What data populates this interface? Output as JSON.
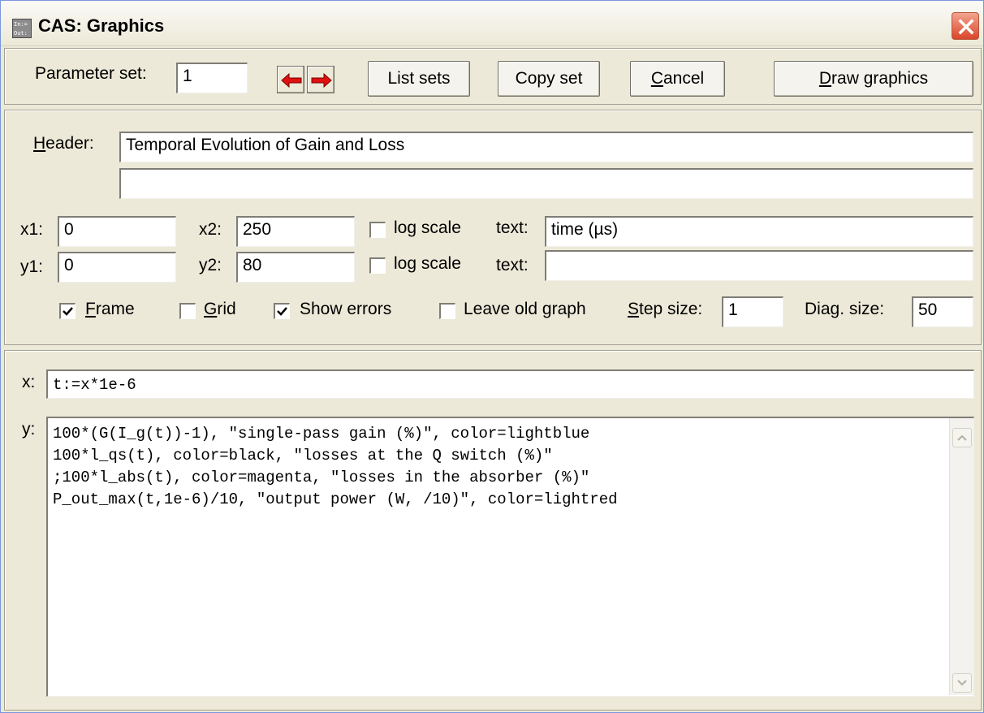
{
  "window": {
    "title": "CAS: Graphics"
  },
  "toolbar": {
    "parameter_set_label": "Parameter set:",
    "parameter_set_value": "1",
    "prev_icon": "red-left-arrow",
    "next_icon": "red-right-arrow",
    "list_sets": "List sets",
    "copy_set": "Copy set",
    "cancel": "Cancel",
    "draw_graphics": "Draw graphics"
  },
  "header": {
    "label": "Header:",
    "line1": "Temporal Evolution of Gain and Loss",
    "line2": ""
  },
  "axes": {
    "x1_label": "x1:",
    "x1_value": "0",
    "x2_label": "x2:",
    "x2_value": "250",
    "y1_label": "y1:",
    "y1_value": "0",
    "y2_label": "y2:",
    "y2_value": "80",
    "x_log_label": "log scale",
    "x_log_checked": false,
    "y_log_label": "log scale",
    "y_log_checked": false,
    "x_text_label": "text:",
    "x_text_value": "time (µs)",
    "y_text_label": "text:",
    "y_text_value": ""
  },
  "options": {
    "frame_label": "Frame",
    "frame_checked": true,
    "grid_label": "Grid",
    "grid_checked": false,
    "show_errors_label": "Show errors",
    "show_errors_checked": true,
    "leave_old_label": "Leave old graph",
    "leave_old_checked": false,
    "step_size_label": "Step size:",
    "step_size_value": "1",
    "diag_size_label": "Diag. size:",
    "diag_size_value": "50"
  },
  "expressions": {
    "x_label": "x:",
    "x_value": "t:=x*1e-6",
    "y_label": "y:",
    "y_lines": [
      "100*(G(I_g(t))-1), \"single-pass gain (%)\", color=lightblue",
      "100*l_qs(t), color=black, \"losses at the Q switch (%)\"",
      ";100*l_abs(t), color=magenta, \"losses in the absorber (%)\"",
      "P_out_max(t,1e-6)/10, \"output power (W, /10)\", color=lightred"
    ]
  },
  "colors": {
    "arrow_red": "#e01010",
    "close_red": "#d9462a",
    "dialog_bg": "#ece9d8"
  }
}
